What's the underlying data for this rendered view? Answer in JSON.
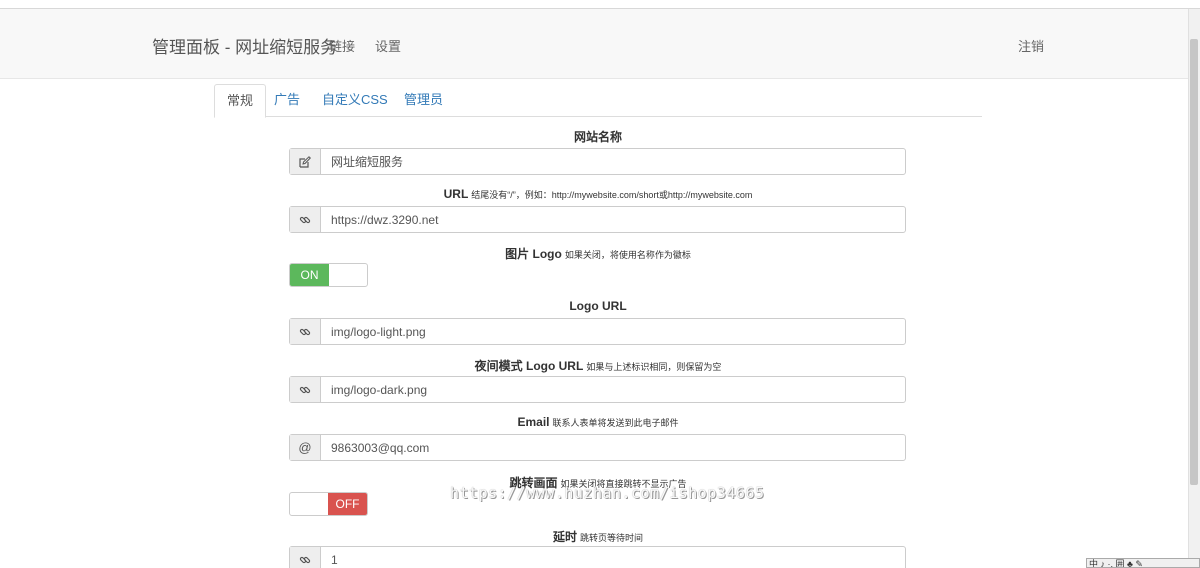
{
  "navbar": {
    "brand": "管理面板 - 网址缩短服务",
    "links": [
      "链接",
      "设置"
    ],
    "logout": "注销"
  },
  "tabs": [
    "常规",
    "广告",
    "自定义CSS",
    "管理员"
  ],
  "fields": {
    "site_name": {
      "label": "网站名称",
      "value": "网址缩短服务",
      "icon": "edit-icon"
    },
    "url": {
      "label": "URL",
      "hint": "结尾没有“/”，例如：http://mywebsite.com/short或http://mywebsite.com",
      "value": "https://dwz.3290.net",
      "icon": "link-icon"
    },
    "image_logo": {
      "label": "图片 Logo",
      "hint": "如果关闭，将使用名称作为徽标",
      "toggle": "ON"
    },
    "logo_url": {
      "label": "Logo URL",
      "value": "img/logo-light.png",
      "icon": "link-icon"
    },
    "dark_logo_url": {
      "label": "夜间模式 Logo URL",
      "hint": "如果与上述标识相同，则保留为空",
      "value": "img/logo-dark.png",
      "icon": "link-icon"
    },
    "email": {
      "label": "Email",
      "hint": "联系人表单将发送到此电子邮件",
      "value": "9863003@qq.com",
      "addon": "@"
    },
    "splash": {
      "label": "跳转画面",
      "hint": "如果关闭将直接跳转不显示广告",
      "toggle": "OFF"
    },
    "delay": {
      "label": "延时",
      "hint": "跳转页等待时间",
      "value": "1",
      "icon": "link-icon"
    }
  },
  "watermark": "https://www.huzhan.com/ishop34665",
  "tray": "中 ♪ ·, 囲 ♣ ✎"
}
